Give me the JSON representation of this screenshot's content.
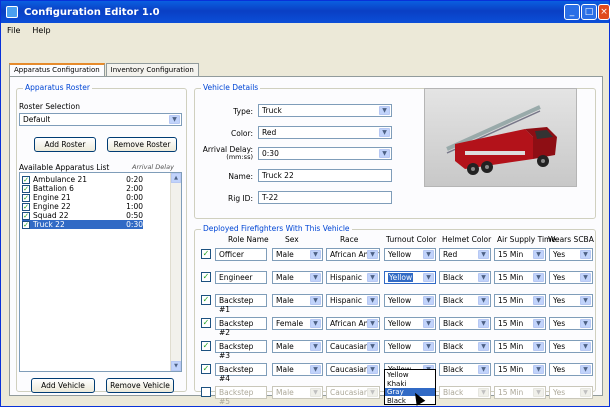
{
  "window": {
    "title": "Configuration Editor 1.0"
  },
  "menu": [
    "File",
    "Help"
  ],
  "tabs": [
    "Apparatus Configuration",
    "Inventory Configuration"
  ],
  "roster": {
    "group_label": "Apparatus Roster",
    "selection_label": "Roster Selection",
    "selection_value": "Default",
    "add_roster": "Add Roster",
    "remove_roster": "Remove Roster",
    "list_label": "Available Apparatus List",
    "delay_label": "Arrival Delay",
    "items": [
      {
        "name": "Ambulance 21",
        "delay": "0:20",
        "checked": true,
        "selected": false
      },
      {
        "name": "Battalion 6",
        "delay": "2:00",
        "checked": true,
        "selected": false
      },
      {
        "name": "Engine 21",
        "delay": "0:00",
        "checked": true,
        "selected": false
      },
      {
        "name": "Engine 22",
        "delay": "1:00",
        "checked": true,
        "selected": false
      },
      {
        "name": "Squad 22",
        "delay": "0:50",
        "checked": true,
        "selected": false
      },
      {
        "name": "Truck 22",
        "delay": "0:30",
        "checked": true,
        "selected": true
      }
    ],
    "add_vehicle": "Add Vehicle",
    "remove_vehicle": "Remove Vehicle"
  },
  "vehicle": {
    "group_label": "Vehicle Details",
    "type_label": "Type:",
    "type_value": "Truck",
    "color_label": "Color:",
    "color_value": "Red",
    "delay_label": "Arrival Delay:",
    "delay_sublabel": "(mm:ss)",
    "delay_value": "0:30",
    "name_label": "Name:",
    "name_value": "Truck 22",
    "rigid_label": "Rig ID:",
    "rigid_value": "T-22"
  },
  "crew": {
    "group_label": "Deployed Firefighters With This Vehicle",
    "headers": [
      "Role Name",
      "Sex",
      "Race",
      "Turnout Color",
      "Helmet Color",
      "Air Supply Time",
      "Wears SCBA"
    ],
    "rows": [
      {
        "checked": true,
        "role": "Officer",
        "sex": "Male",
        "race": "African Amer",
        "turnout": "Yellow",
        "helmet": "Red",
        "air": "15 Min",
        "scba": "Yes",
        "disabled": false
      },
      {
        "checked": true,
        "role": "Engineer",
        "sex": "Male",
        "race": "Hispanic",
        "turnout": "Yellow",
        "helmet": "Black",
        "air": "15 Min",
        "scba": "Yes",
        "disabled": false
      },
      {
        "checked": true,
        "role": "Backstep #1",
        "sex": "Male",
        "race": "Hispanic",
        "turnout": "Yellow",
        "helmet": "Black",
        "air": "15 Min",
        "scba": "Yes",
        "disabled": false
      },
      {
        "checked": true,
        "role": "Backstep #2",
        "sex": "Female",
        "race": "African Amer",
        "turnout": "Yellow",
        "helmet": "Black",
        "air": "15 Min",
        "scba": "Yes",
        "disabled": false
      },
      {
        "checked": true,
        "role": "Backstep #3",
        "sex": "Male",
        "race": "Caucasian",
        "turnout": "Yellow",
        "helmet": "Black",
        "air": "15 Min",
        "scba": "Yes",
        "disabled": false
      },
      {
        "checked": true,
        "role": "Backstep #4",
        "sex": "Male",
        "race": "Caucasian",
        "turnout": "Yellow",
        "helmet": "Black",
        "air": "15 Min",
        "scba": "Yes",
        "disabled": false
      },
      {
        "checked": false,
        "role": "Backstep #5",
        "sex": "Male",
        "race": "Caucasian",
        "turnout": "Yellow",
        "helmet": "Black",
        "air": "15 Min",
        "scba": "Yes",
        "disabled": true
      }
    ],
    "dropdown_options": [
      "Yellow",
      "Khaki",
      "Gray",
      "Black"
    ],
    "dropdown_highlighted": "Gray"
  },
  "colors": {
    "title_bar": "#0a3fc4",
    "selection": "#316ac5",
    "group_label": "#0046d5",
    "tab_accent": "#e68b2c"
  },
  "icons": [
    "app-icon",
    "minimize-icon",
    "maximize-icon",
    "close-icon",
    "chevron-down-icon",
    "check-icon",
    "fire-truck-image",
    "mouse-cursor-icon"
  ]
}
